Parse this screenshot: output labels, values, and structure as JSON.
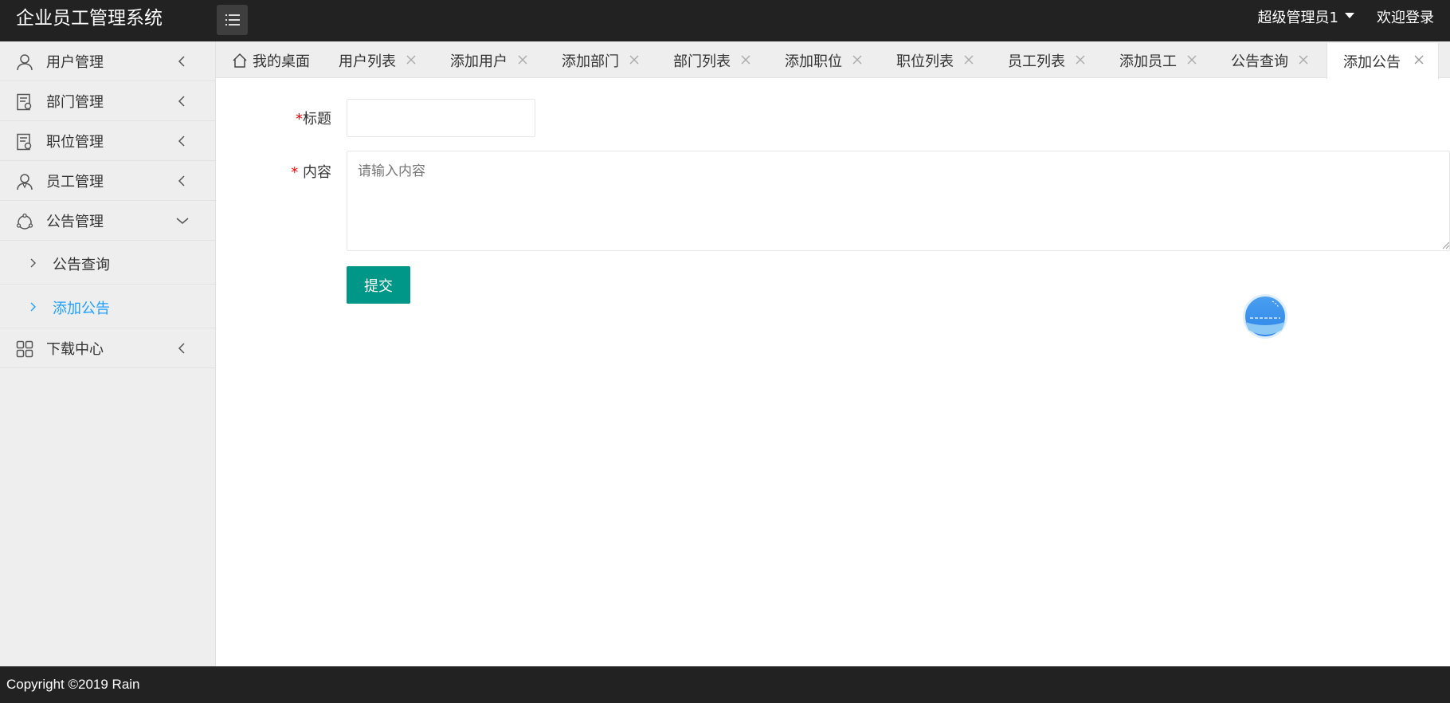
{
  "header": {
    "title": "企业员工管理系统",
    "admin_name": "超级管理员1",
    "welcome": "欢迎登录"
  },
  "sidebar": {
    "items": [
      {
        "label": "用户管理",
        "icon": "user-icon"
      },
      {
        "label": "部门管理",
        "icon": "document-icon"
      },
      {
        "label": "职位管理",
        "icon": "document-icon"
      },
      {
        "label": "员工管理",
        "icon": "employee-icon"
      },
      {
        "label": "公告管理",
        "icon": "notice-icon",
        "expanded": true,
        "children": [
          {
            "label": "公告查询",
            "active": false
          },
          {
            "label": "添加公告",
            "active": true
          }
        ]
      },
      {
        "label": "下载中心",
        "icon": "grid-icon"
      }
    ]
  },
  "tabs": [
    {
      "label": "我的桌面",
      "icon": "home-icon"
    },
    {
      "label": "用户列表"
    },
    {
      "label": "添加用户"
    },
    {
      "label": "添加部门"
    },
    {
      "label": "部门列表"
    },
    {
      "label": "添加职位"
    },
    {
      "label": "职位列表"
    },
    {
      "label": "员工列表"
    },
    {
      "label": "添加员工"
    },
    {
      "label": "公告查询"
    },
    {
      "label": "添加公告",
      "active": true
    }
  ],
  "form": {
    "title_label": "标题",
    "title_value": "",
    "content_label": "内容",
    "content_placeholder": "请输入内容",
    "required_mark": "*",
    "submit_label": "提交"
  },
  "footer": {
    "copyright": "Copyright ©2019 Rain"
  },
  "colors": {
    "header_bg": "#222222",
    "sidebar_bg": "#eeeeee",
    "active_link": "#1e9fff",
    "submit_bg": "#009688",
    "required": "#ff0000"
  }
}
